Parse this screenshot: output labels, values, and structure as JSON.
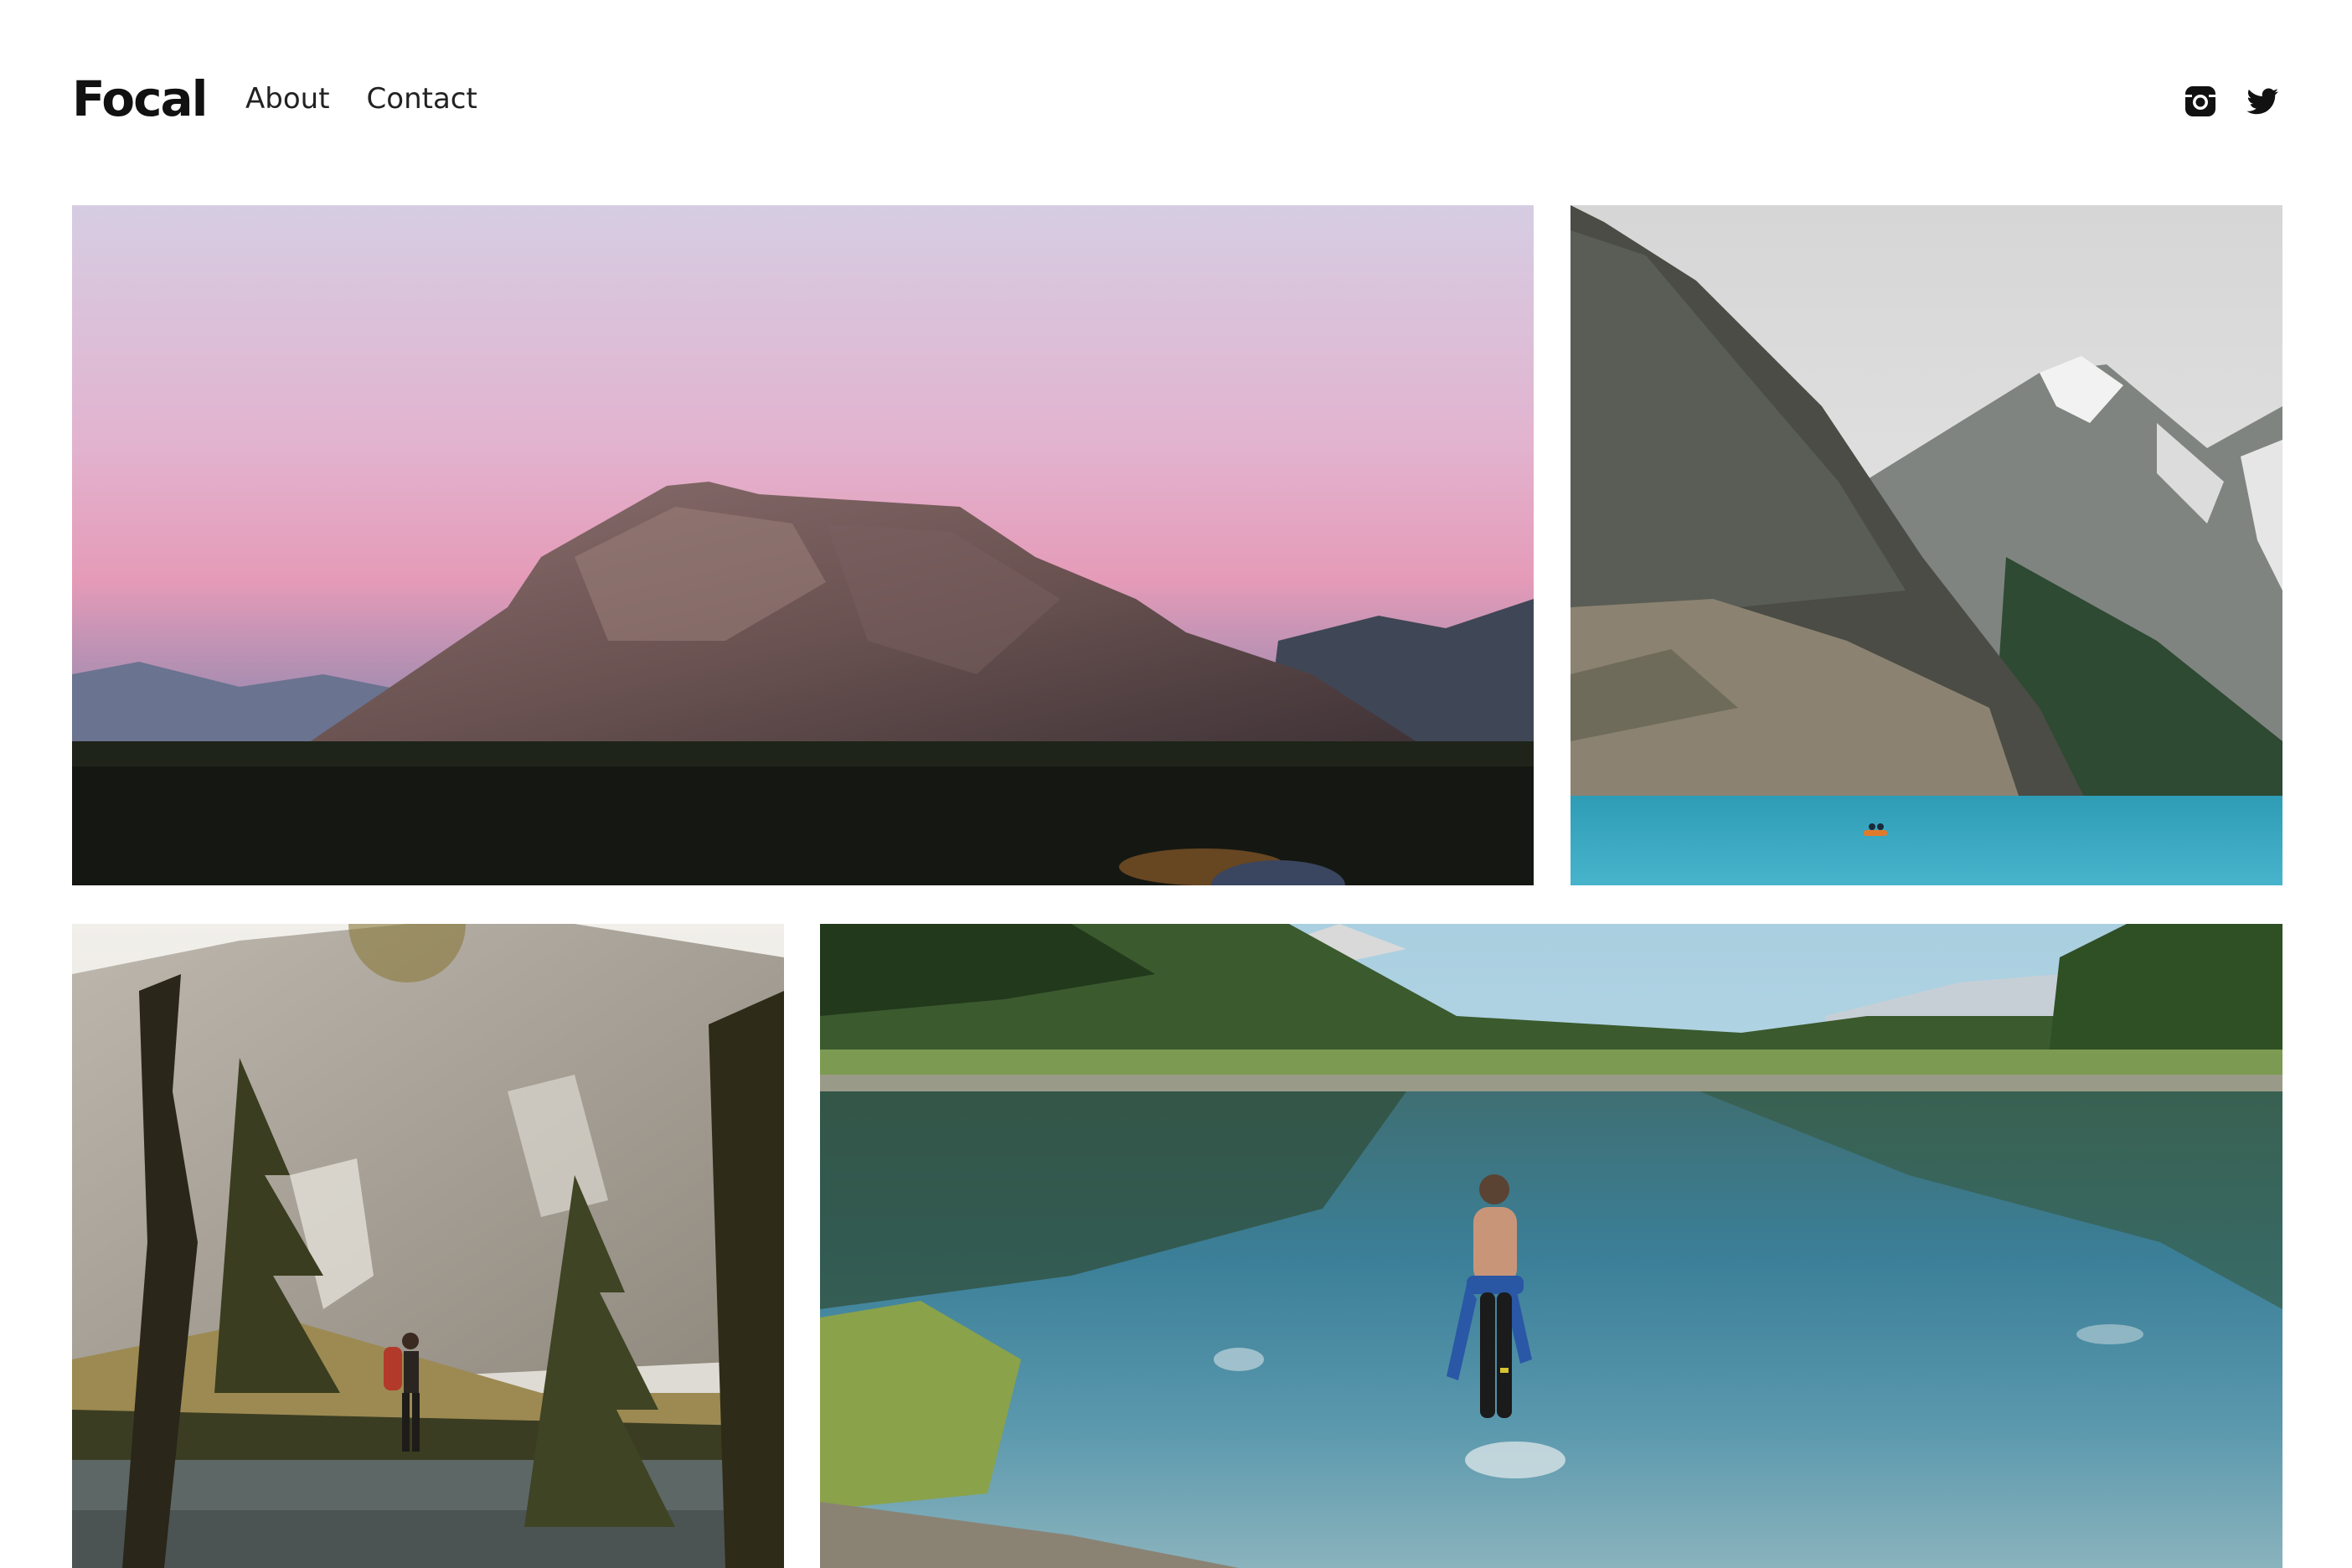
{
  "site": {
    "logo": "Focal"
  },
  "nav": {
    "items": [
      {
        "label": "About"
      },
      {
        "label": "Contact"
      }
    ]
  },
  "social": {
    "icons": [
      "instagram-icon",
      "twitter-icon"
    ]
  },
  "gallery": {
    "photos": [
      {
        "name": "mountain-sunset-photo",
        "palette": [
          "#d9c9df",
          "#e7a6c0",
          "#5a4a4e",
          "#141712"
        ]
      },
      {
        "name": "glacier-lake-canoe-photo",
        "palette": [
          "#e0e0e0",
          "#6b6e66",
          "#3e4a3a",
          "#39a7bf"
        ]
      },
      {
        "name": "hiker-by-lake-photo",
        "palette": [
          "#e6e4df",
          "#a59e92",
          "#3b3a24",
          "#5d6564"
        ]
      },
      {
        "name": "swimmer-in-lake-photo",
        "palette": [
          "#b9dbe8",
          "#2f4a22",
          "#3b7b92",
          "#6fa4b5"
        ]
      }
    ]
  },
  "colors": {
    "text": "#111111",
    "nav_text": "#222222",
    "background": "#ffffff"
  }
}
